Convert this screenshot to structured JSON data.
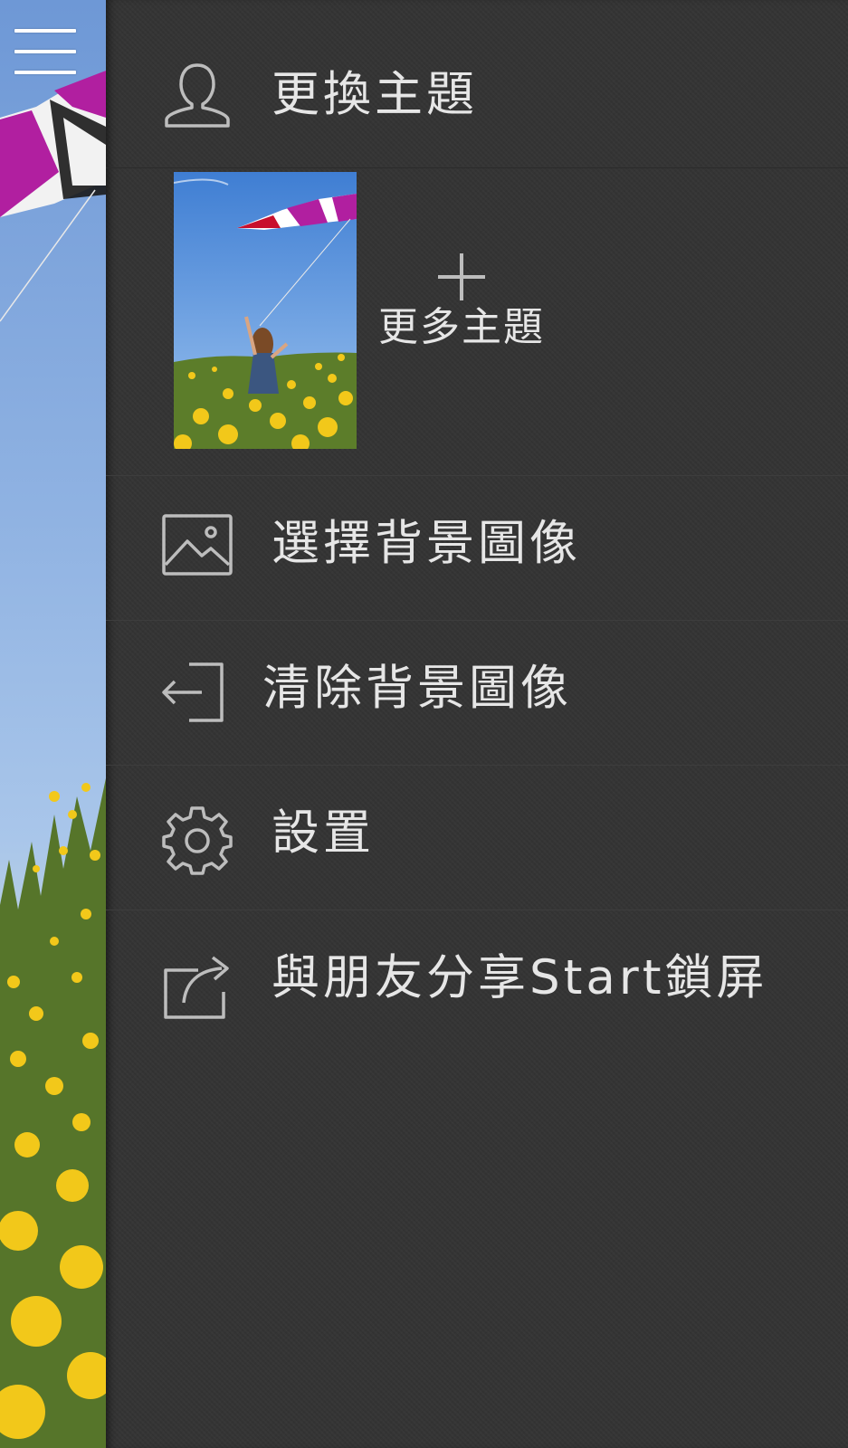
{
  "menu_button": {
    "icon": "hamburger-menu-icon"
  },
  "drawer": {
    "header": {
      "icon": "user-icon",
      "label": "更換主題"
    },
    "themes": {
      "thumbnail": "kite-meadow-theme",
      "more_icon": "plus-icon",
      "more_label": "更多主題"
    },
    "items": [
      {
        "icon": "image-icon",
        "label": "選擇背景圖像"
      },
      {
        "icon": "sign-out-icon",
        "label": "清除背景圖像"
      },
      {
        "icon": "gear-icon",
        "label": "設置"
      },
      {
        "icon": "share-icon",
        "label": "與朋友分享Start鎖屏"
      }
    ]
  },
  "colors": {
    "drawer_bg": "#343434",
    "text": "#e6e6e6",
    "icon": "#bdbdbd",
    "sky": "#7fa6dc",
    "flowers": "#f2c81a",
    "kite": "#b11fa0"
  }
}
